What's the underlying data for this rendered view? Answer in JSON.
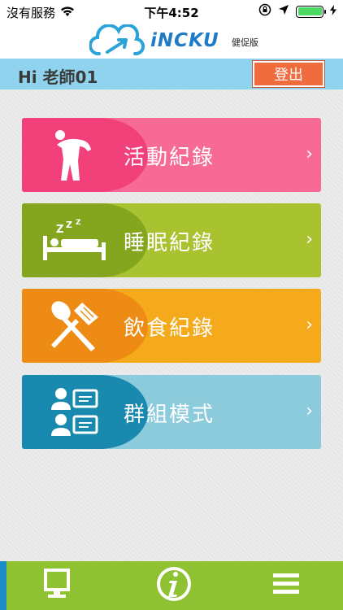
{
  "status_bar": {
    "carrier": "沒有服務",
    "time": "下午4:52",
    "battery_level": 1.0,
    "battery_color": "#4cd964"
  },
  "header": {
    "logo_text": "iNCKU",
    "logo_sub": "健促版",
    "logo_icon": "cloud-icon"
  },
  "user_bar": {
    "greeting": "Hi 老師01",
    "logout_label": "登出"
  },
  "menu": {
    "items": [
      {
        "label": "活動紀錄",
        "icon": "exercise-icon",
        "chevron": "›",
        "color": "#f76a96"
      },
      {
        "label": "睡眠紀錄",
        "icon": "sleep-bed-icon",
        "chevron": "›",
        "color": "#a9c230"
      },
      {
        "label": "飲食紀錄",
        "icon": "utensils-icon",
        "chevron": "›",
        "color": "#f5aa1b"
      },
      {
        "label": "群組模式",
        "icon": "group-chat-icon",
        "chevron": "›",
        "color": "#8ccbdc"
      }
    ]
  },
  "bottom_nav": {
    "items": [
      {
        "icon": "monitor-icon"
      },
      {
        "icon": "info-icon",
        "text": "i"
      },
      {
        "icon": "hamburger-menu-icon"
      }
    ],
    "background": "#8ec232"
  }
}
